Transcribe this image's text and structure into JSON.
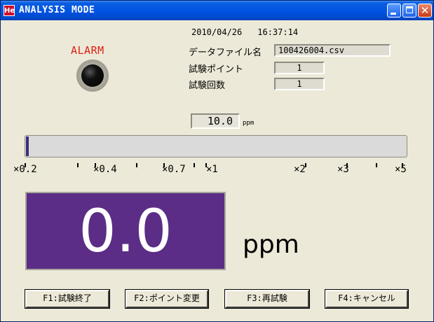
{
  "window": {
    "app_icon_text": "He",
    "title": "ANALYSIS MODE",
    "controls": {
      "minimize": "minimize-icon",
      "maximize": "maximize-icon",
      "close": "close-icon",
      "close_glyph": "✕"
    }
  },
  "header": {
    "date": "2010/04/26",
    "time": "16:37:14"
  },
  "alarm": {
    "label": "ALARM",
    "state": "off",
    "lamp_color": "#000000",
    "label_color": "#e02010"
  },
  "info": {
    "data_file_label": "データファイル名",
    "data_file_value": "100426004.csv",
    "test_point_label": "試験ポイント",
    "test_point_value": "1",
    "test_count_label": "試験回数",
    "test_count_value": "1"
  },
  "concentration": {
    "value": "10.0",
    "unit": "ppm"
  },
  "ratio_bar": {
    "fill_fraction": 0.008,
    "fill_color": "#3d2b7a",
    "scale_labels": [
      "×0.2",
      "×0.4",
      "×0.7",
      "×1",
      "×2",
      "×3",
      "×5"
    ]
  },
  "reading": {
    "value": "0.0",
    "unit": "ppm",
    "background_color": "#5b2d86"
  },
  "buttons": {
    "f1": "F1:試験終了",
    "f2": "F2:ポイント変更",
    "f3": "F3:再試験",
    "f4": "F4:キャンセル"
  }
}
